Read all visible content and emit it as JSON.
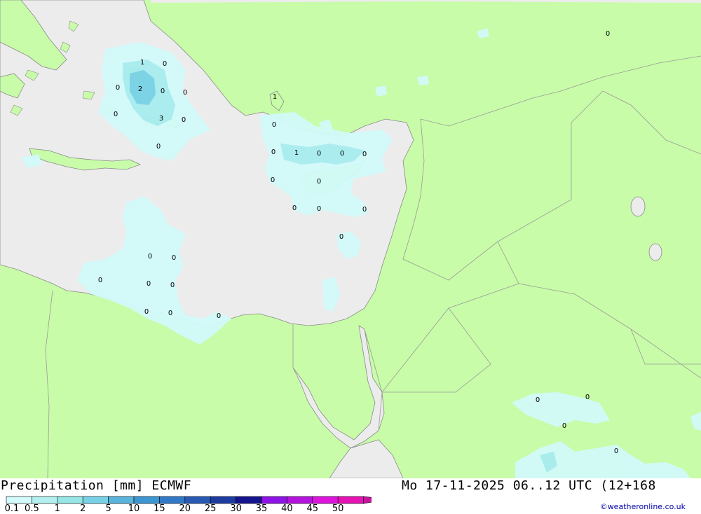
{
  "footer": {
    "title": "Precipitation [mm] ECMWF",
    "datetime": "Mo 17-11-2025 06..12 UTC (12+168",
    "credit": "©weatheronline.co.uk"
  },
  "legend": {
    "ticks": [
      "0.1",
      "0.5",
      "1",
      "2",
      "5",
      "10",
      "15",
      "20",
      "25",
      "30",
      "35",
      "40",
      "45",
      "50"
    ],
    "colors": [
      "#d2fafa",
      "#b4f0f0",
      "#96e6e6",
      "#78d2e6",
      "#5ab4dc",
      "#3c96d2",
      "#3278c8",
      "#285ab4",
      "#1e3ca0",
      "#14148c",
      "#8c14e6",
      "#b414dc",
      "#dc14dc",
      "#e614b4",
      "#c814a0"
    ]
  },
  "map": {
    "colors": {
      "land": "#c8fca8",
      "sea": "#ececec",
      "precip_light": "#d2fafa",
      "precip_mid": "#a8ecf0",
      "precip_heavy": "#78d2e6",
      "border": "#9a9a9a"
    },
    "labels": [
      {
        "text": "1"
      },
      {
        "text": "0"
      },
      {
        "text": "0"
      },
      {
        "text": "2"
      },
      {
        "text": "0"
      },
      {
        "text": "0"
      },
      {
        "text": "0"
      },
      {
        "text": "3"
      },
      {
        "text": "0"
      },
      {
        "text": "0"
      },
      {
        "text": "1"
      },
      {
        "text": "0"
      },
      {
        "text": "0"
      },
      {
        "text": "1"
      },
      {
        "text": "0"
      },
      {
        "text": "0"
      },
      {
        "text": "0"
      },
      {
        "text": "0"
      },
      {
        "text": "0"
      },
      {
        "text": "0"
      },
      {
        "text": "0"
      },
      {
        "text": "0"
      },
      {
        "text": "0"
      },
      {
        "text": "0"
      },
      {
        "text": "0"
      },
      {
        "text": "0"
      },
      {
        "text": "0"
      },
      {
        "text": "0"
      },
      {
        "text": "0"
      },
      {
        "text": "0"
      },
      {
        "text": "0"
      },
      {
        "text": "0"
      },
      {
        "text": "0"
      },
      {
        "text": "0"
      },
      {
        "text": "0"
      },
      {
        "text": "0"
      }
    ]
  }
}
